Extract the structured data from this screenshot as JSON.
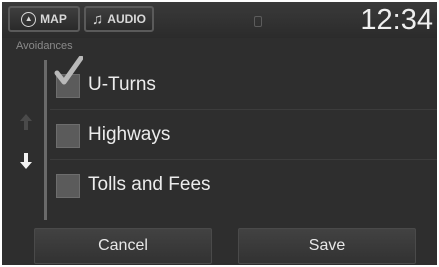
{
  "topbar": {
    "map_label": "MAP",
    "map_icon": "compass-icon",
    "audio_label": "AUDIO",
    "audio_icon": "music-note-icon",
    "clock": "12:34"
  },
  "section": {
    "title": "Avoidances"
  },
  "options": [
    {
      "label": "U-Turns",
      "checked": true
    },
    {
      "label": "Highways",
      "checked": false
    },
    {
      "label": "Tolls and Fees",
      "checked": false
    }
  ],
  "footer": {
    "cancel_label": "Cancel",
    "save_label": "Save"
  },
  "colors": {
    "background": "#2e2e2e",
    "text": "#ececec",
    "checkbox": "#5b5b5b"
  }
}
